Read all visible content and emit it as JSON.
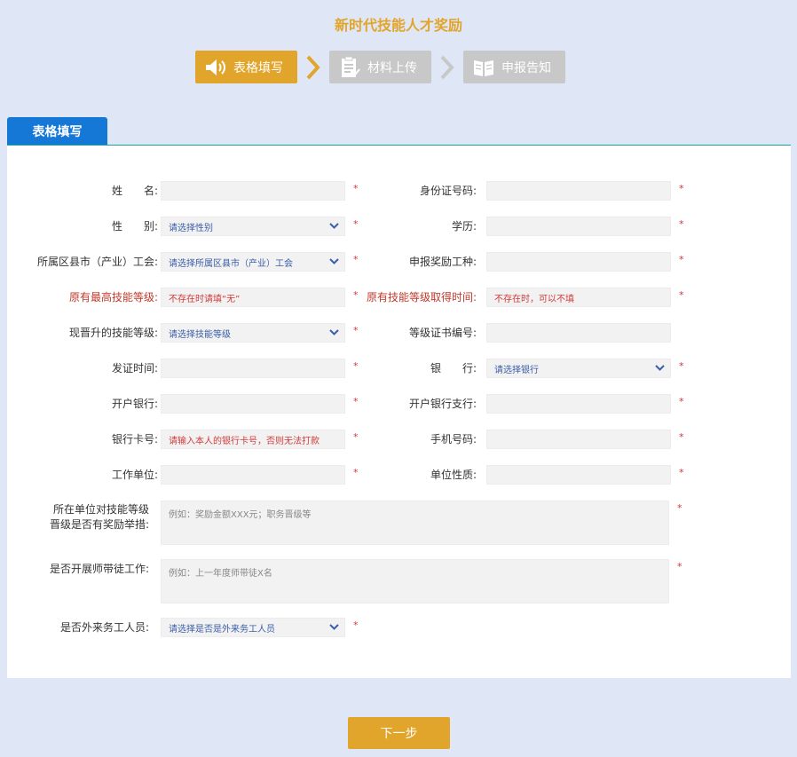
{
  "page_title": "新时代技能人才奖励",
  "steps": [
    {
      "label": "表格填写",
      "state": "active",
      "icon": "speaker-icon"
    },
    {
      "label": "材料上传",
      "state": "inactive",
      "icon": "checklist-icon"
    },
    {
      "label": "申报告知",
      "state": "inactive",
      "icon": "book-icon"
    }
  ],
  "tab_label": "表格填写",
  "required_mark": "*",
  "form": {
    "name_label": "姓　　名:",
    "id_label": "身份证号码:",
    "gender_label": "性　　别:",
    "gender_select": "请选择性别",
    "education_label": "学历:",
    "district_label": "所属区县市（产业）工会:",
    "district_select": "请选择所属区县市（产业）工会",
    "award_type_label": "申报奖励工种:",
    "orig_level_label": "原有最高技能等级:",
    "orig_level_placeholder": "不存在时请填“无”",
    "orig_time_label": "原有技能等级取得时间:",
    "orig_time_placeholder": "不存在时，可以不填",
    "new_level_label": "现晋升的技能等级:",
    "new_level_select": "请选择技能等级",
    "cert_no_label": "等级证书编号:",
    "issue_time_label": "发证时间:",
    "bank_label": "银　　行:",
    "bank_select": "请选择银行",
    "open_bank_label": "开户银行:",
    "open_branch_label": "开户银行支行:",
    "card_label": "银行卡号:",
    "card_placeholder": "请输入本人的银行卡号，否则无法打款",
    "phone_label": "手机号码:",
    "employer_label": "工作单位:",
    "employer_type_label": "单位性质:",
    "incentive_label_1": "所在单位对技能等级",
    "incentive_label_2": "晋级是否有奖励举措:",
    "incentive_placeholder": "例如：奖励金额XXX元；职务晋级等",
    "mentor_label": "是否开展师带徒工作:",
    "mentor_placeholder": "例如：上一年度师带徒X名",
    "migrant_label": "是否外来务工人员:",
    "migrant_select": "请选择是否是外来务工人员"
  },
  "next_button": "下一步",
  "colors": {
    "accent": "#e2a52b",
    "tab": "#1577d6",
    "required": "#d23a3a",
    "background": "#dfe7f7"
  }
}
